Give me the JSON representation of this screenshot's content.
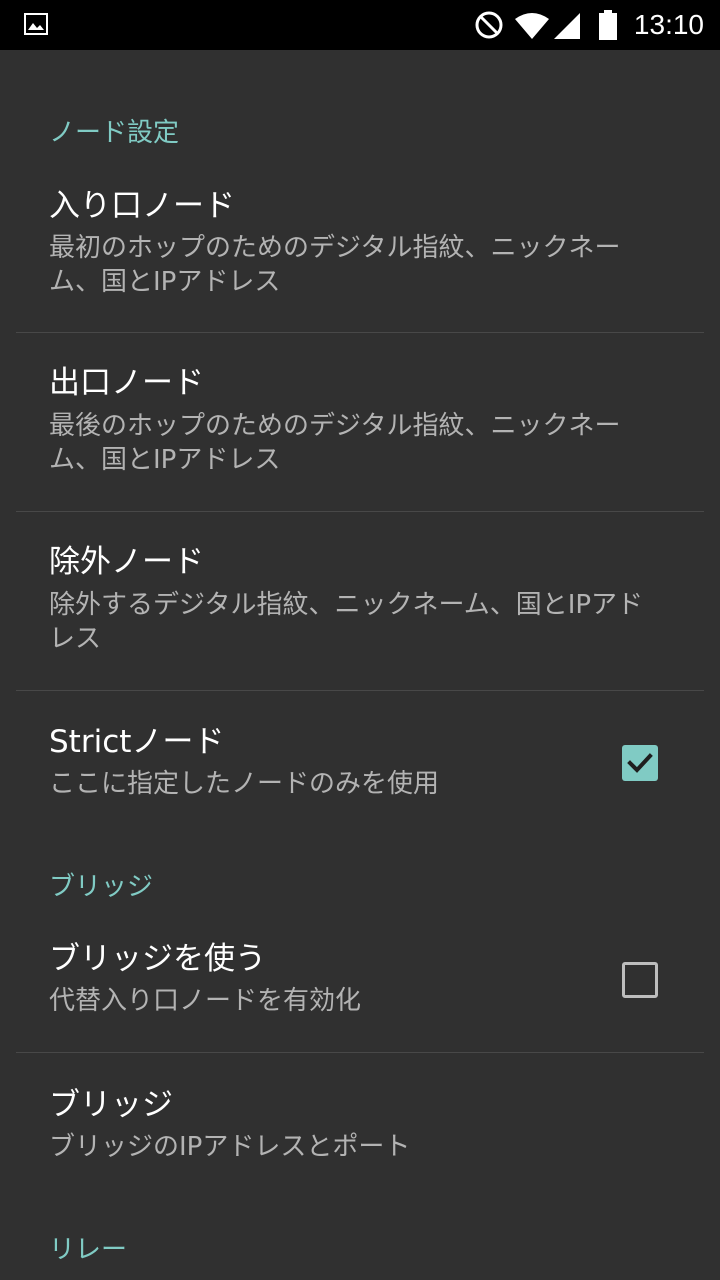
{
  "status_bar": {
    "time": "13:10",
    "icons": [
      "image-icon",
      "do-not-disturb-icon",
      "wifi-icon",
      "signal-icon",
      "battery-icon"
    ]
  },
  "sections": [
    {
      "header": "ノード設定",
      "items": [
        {
          "title": "入り口ノード",
          "summary": "最初のホップのためのデジタル指紋、ニックネーム、国とIPアドレス"
        },
        {
          "title": "出口ノード",
          "summary": "最後のホップのためのデジタル指紋、ニックネーム、国とIPアドレス"
        },
        {
          "title": "除外ノード",
          "summary": "除外するデジタル指紋、ニックネーム、国とIPアドレス"
        },
        {
          "title": "Strictノード",
          "summary": "ここに指定したノードのみを使用",
          "checked": true
        }
      ]
    },
    {
      "header": "ブリッジ",
      "items": [
        {
          "title": "ブリッジを使う",
          "summary": "代替入り口ノードを有効化",
          "checked": false
        },
        {
          "title": "ブリッジ",
          "summary": "ブリッジのIPアドレスとポート"
        }
      ]
    },
    {
      "header": "リレー",
      "items": []
    }
  ],
  "colors": {
    "background": "#303030",
    "accent": "#80cbc4",
    "title": "#ffffff",
    "summary": "#b3b3b3",
    "status_bar": "#000000"
  }
}
